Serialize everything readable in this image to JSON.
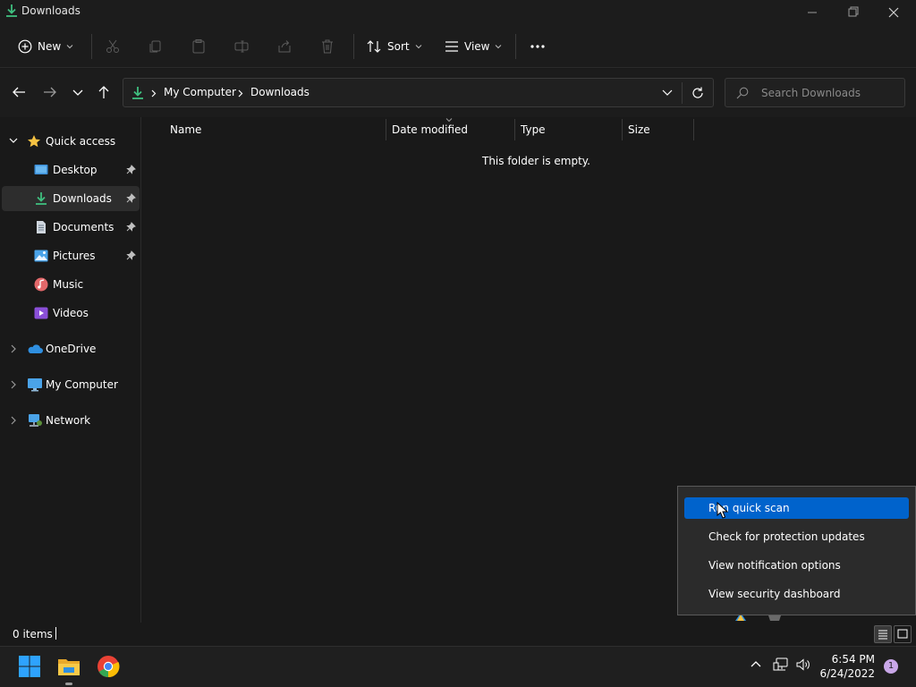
{
  "window": {
    "title": "Downloads"
  },
  "commandbar": {
    "new_label": "New",
    "sort_label": "Sort",
    "view_label": "View"
  },
  "address": {
    "crumbs": [
      "My Computer",
      "Downloads"
    ]
  },
  "search": {
    "placeholder": "Search Downloads"
  },
  "sidebar": {
    "quick_access": {
      "label": "Quick access",
      "items": [
        {
          "label": "Desktop",
          "icon": "desktop-icon",
          "pinned": true
        },
        {
          "label": "Downloads",
          "icon": "download-icon",
          "pinned": true,
          "selected": true
        },
        {
          "label": "Documents",
          "icon": "documents-icon",
          "pinned": true
        },
        {
          "label": "Pictures",
          "icon": "pictures-icon",
          "pinned": true
        },
        {
          "label": "Music",
          "icon": "music-icon",
          "pinned": false
        },
        {
          "label": "Videos",
          "icon": "videos-icon",
          "pinned": false
        }
      ]
    },
    "roots": [
      {
        "label": "OneDrive",
        "icon": "onedrive-icon"
      },
      {
        "label": "My Computer",
        "icon": "computer-icon"
      },
      {
        "label": "Network",
        "icon": "network-icon"
      }
    ]
  },
  "file_list": {
    "columns": [
      "Name",
      "Date modified",
      "Type",
      "Size"
    ],
    "empty_message": "This folder is empty."
  },
  "status": {
    "item_count": "0 items"
  },
  "context_menu": {
    "items": [
      {
        "label": "Run quick scan",
        "highlighted": true
      },
      {
        "label": "Check for protection updates",
        "highlighted": false
      },
      {
        "label": "View notification options",
        "highlighted": false
      },
      {
        "label": "View security dashboard",
        "highlighted": false
      }
    ]
  },
  "taskbar": {
    "apps": [
      "start-icon",
      "file-explorer-icon",
      "chrome-icon"
    ],
    "clock": {
      "time": "6:54 PM",
      "date": "6/24/2022"
    },
    "notification_count": "1"
  },
  "colors": {
    "accent": "#0063cc",
    "download_green": "#3fbf7f",
    "background": "#191919"
  }
}
